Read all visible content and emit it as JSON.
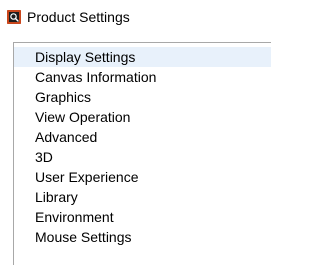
{
  "window": {
    "title": "Product Settings",
    "icon": "app-logo-icon"
  },
  "settings_list": {
    "selected_index": 0,
    "items": [
      {
        "label": "Display Settings"
      },
      {
        "label": "Canvas Information"
      },
      {
        "label": "Graphics"
      },
      {
        "label": "View Operation"
      },
      {
        "label": "Advanced"
      },
      {
        "label": "3D"
      },
      {
        "label": "User Experience"
      },
      {
        "label": "Library"
      },
      {
        "label": "Environment"
      },
      {
        "label": "Mouse Settings"
      }
    ]
  },
  "colors": {
    "selected_background": "#e8f1fb",
    "panel_border": "#a8a8a8",
    "icon_background": "#c9461c"
  }
}
